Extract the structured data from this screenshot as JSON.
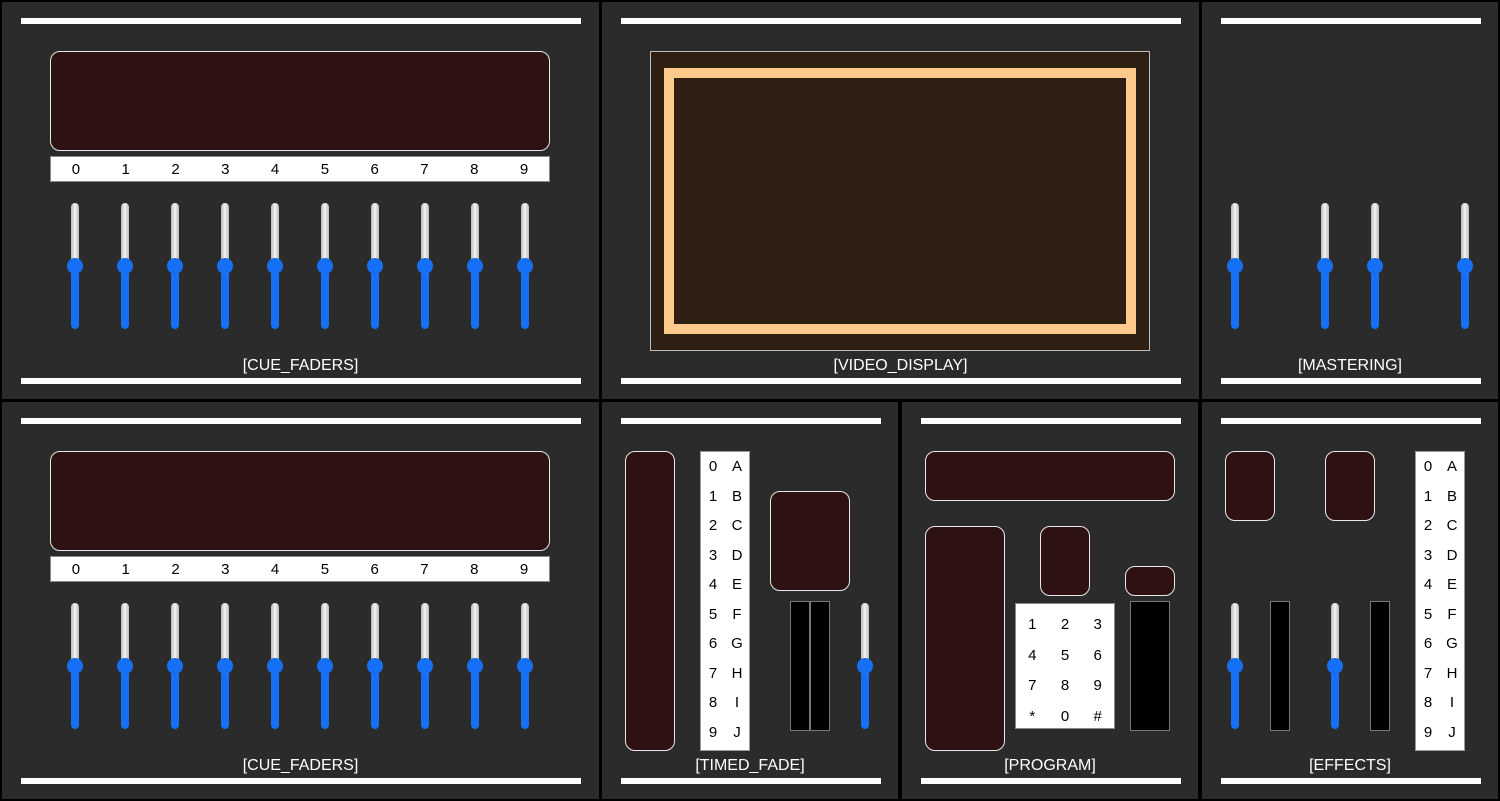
{
  "panels": {
    "cue_faders_top": {
      "label": "[CUE_FADERS]"
    },
    "video_display": {
      "label": "[VIDEO_DISPLAY]"
    },
    "mastering": {
      "label": "[MASTERING]"
    },
    "cue_faders_bottom": {
      "label": "[CUE_FADERS]"
    },
    "timed_fade": {
      "label": "[TIMED_FADE]"
    },
    "program": {
      "label": "[PROGRAM]"
    },
    "effects": {
      "label": "[EFFECTS]"
    }
  },
  "cue_channels": [
    "0",
    "1",
    "2",
    "3",
    "4",
    "5",
    "6",
    "7",
    "8",
    "9"
  ],
  "alpha_rows": [
    [
      "0",
      "A"
    ],
    [
      "1",
      "B"
    ],
    [
      "2",
      "C"
    ],
    [
      "3",
      "D"
    ],
    [
      "4",
      "E"
    ],
    [
      "5",
      "F"
    ],
    [
      "6",
      "G"
    ],
    [
      "7",
      "H"
    ],
    [
      "8",
      "I"
    ],
    [
      "9",
      "J"
    ]
  ],
  "keypad_keys": [
    "1",
    "2",
    "3",
    "4",
    "5",
    "6",
    "7",
    "8",
    "9",
    "*",
    "0",
    "#"
  ],
  "fader_level": 0.5,
  "colors": {
    "accent": "#1670f5",
    "panel": "#2b2b2b",
    "display": "#2e1112",
    "video_frame": "#fdca8b"
  }
}
